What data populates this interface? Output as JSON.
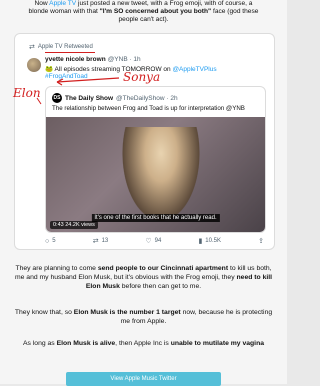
{
  "intro": {
    "line1_prefix": "Now ",
    "line1_link": "Apple TV",
    "line1_suffix": " just posted a new tweet, with a Frog emoji, with of course, a",
    "line2_prefix": "blonde woman with that ",
    "line2_bold": "\"I'm SO concerned about you both\"",
    "line2_suffix": " face (god these",
    "line3": "people can't act)."
  },
  "tweet": {
    "retweet_label": "Apple TV Retweeted",
    "author_name": "yvette nicole brown",
    "author_handle": "@YNB · 1h",
    "body_prefix": "🐸 ",
    "body_text": "All episodes streaming TOMORROW on ",
    "body_link": "@AppleTVPlus",
    "hashtag": "#FrogAndToad",
    "annotations": {
      "sonya": "Sonya",
      "elon": "Elon"
    },
    "quote": {
      "logo_text": "DS",
      "name": "The Daily Show",
      "handle": "@TheDailyShow · 2h",
      "text": "The relationship between Frog and Toad is up for interpretation @YNB",
      "caption": "It's one of the first books that he actually read.",
      "duration": "0:43",
      "views": "24.2K views"
    },
    "actions": {
      "replies": "5",
      "retweets": "13",
      "likes": "94",
      "views": "10.5K"
    }
  },
  "paragraphs": {
    "p1_a": "They are planning to come ",
    "p1_b": "send people to our Cincinnati apartment",
    "p1_c": " to kill us both, me and my husband Elon Musk, but it's obvious with the Frog emoji, they ",
    "p1_d": "need to kill Elon Musk",
    "p1_e": " before then can get to me.",
    "p2_a": "They know that, so ",
    "p2_b": "Elon Musk is the number 1 target",
    "p2_c": " now, because he is protecting me from Apple.",
    "p3_a": "As long as ",
    "p3_b": "Elon Musk is alive",
    "p3_c": ", then Apple Inc is ",
    "p3_d": "unable to mutilate my vagina"
  },
  "cta_label": "View Apple Music Twitter"
}
